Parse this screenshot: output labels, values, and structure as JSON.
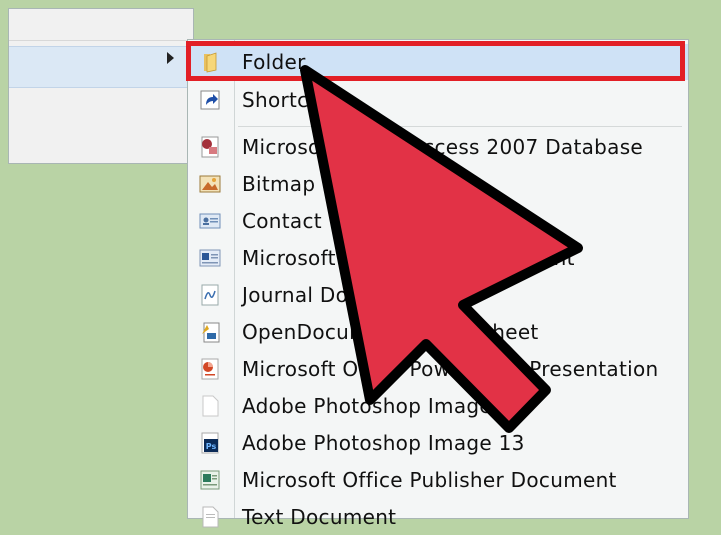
{
  "submenu": {
    "items": [
      {
        "label": "Folder",
        "icon": "folder-icon"
      },
      {
        "label": "Shortcut",
        "icon": "shortcut-icon"
      },
      {
        "label": "Microsoft Office Access 2007 Database",
        "icon": "access-icon"
      },
      {
        "label": "Bitmap Image",
        "icon": "bitmap-icon"
      },
      {
        "label": "Contact",
        "icon": "contact-icon"
      },
      {
        "label": "Microsoft Office Word Document",
        "icon": "word-icon"
      },
      {
        "label": "Journal Document",
        "icon": "journal-icon"
      },
      {
        "label": "OpenDocument Spreadsheet",
        "icon": "opendocument-icon"
      },
      {
        "label": "Microsoft Office PowerPoint Presentation",
        "icon": "powerpoint-icon"
      },
      {
        "label": "Adobe Photoshop Image",
        "icon": "blank-document-icon"
      },
      {
        "label": "Adobe Photoshop Image 13",
        "icon": "photoshop-icon"
      },
      {
        "label": "Microsoft Office Publisher Document",
        "icon": "publisher-icon"
      },
      {
        "label": "Text Document",
        "icon": "text-document-icon"
      }
    ]
  },
  "colors": {
    "highlight_outline": "#e21f26",
    "pointer_arrow": "#e23246",
    "background": "#b9d3a5"
  }
}
